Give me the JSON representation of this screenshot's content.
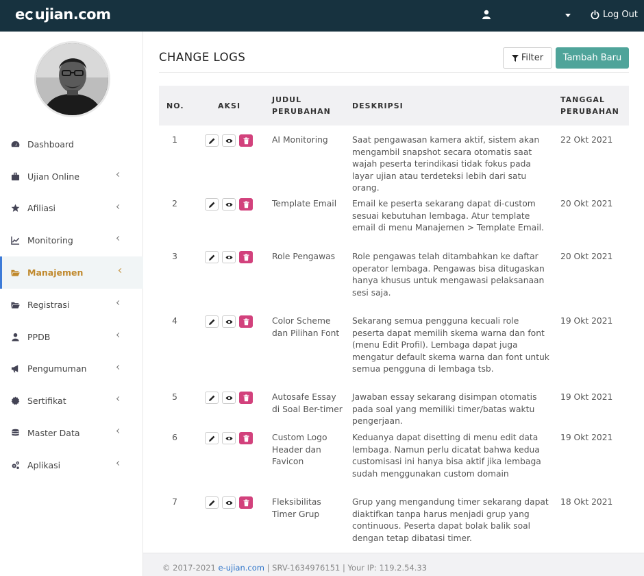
{
  "topbar": {
    "logo": "e-ujian.com",
    "logo_before": "e",
    "logo_after": "ujian.com",
    "logout_label": "Log Out"
  },
  "sidebar": {
    "items": [
      {
        "label": "Dashboard",
        "icon": "dashboard-icon",
        "has_chevron": false,
        "active": false
      },
      {
        "label": "Ujian Online",
        "icon": "briefcase-icon",
        "has_chevron": true,
        "active": false
      },
      {
        "label": "Afiliasi",
        "icon": "star-icon",
        "has_chevron": true,
        "active": false
      },
      {
        "label": "Monitoring",
        "icon": "line-chart-icon",
        "has_chevron": true,
        "active": false
      },
      {
        "label": "Manajemen",
        "icon": "folder-open-icon",
        "has_chevron": true,
        "active": true
      },
      {
        "label": "Registrasi",
        "icon": "folder-open-icon",
        "has_chevron": true,
        "active": false
      },
      {
        "label": "PPDB",
        "icon": "user-icon",
        "has_chevron": true,
        "active": false
      },
      {
        "label": "Pengumuman",
        "icon": "bullhorn-icon",
        "has_chevron": true,
        "active": false
      },
      {
        "label": "Sertifikat",
        "icon": "certificate-icon",
        "has_chevron": true,
        "active": false
      },
      {
        "label": "Master Data",
        "icon": "database-icon",
        "has_chevron": true,
        "active": false
      },
      {
        "label": "Aplikasi",
        "icon": "cogs-icon",
        "has_chevron": true,
        "active": false
      }
    ]
  },
  "page": {
    "title": "CHANGE LOGS",
    "filter_label": "Filter",
    "add_label": "Tambah Baru"
  },
  "table": {
    "headers": {
      "no": "NO.",
      "aksi": "AKSI",
      "judul": "JUDUL PERUBAHAN",
      "deskripsi": "DESKRIPSI",
      "tanggal": "TANGGAL PERUBAHAN"
    },
    "rows": [
      {
        "no": "1",
        "judul": "AI Monitoring",
        "deskripsi": "Saat pengawasan kamera aktif, sistem akan mengambil snapshot secara otomatis saat wajah peserta terindikasi tidak fokus pada layar ujian atau terdeteksi lebih dari satu orang.",
        "tanggal": "22 Okt 2021"
      },
      {
        "no": "2",
        "judul": "Template Email",
        "deskripsi": "Email ke peserta sekarang dapat di-custom sesuai kebutuhan lembaga. Atur template email di menu Manajemen > Template Email.",
        "tanggal": "20 Okt 2021"
      },
      {
        "no": "3",
        "judul": "Role Pengawas",
        "deskripsi": "Role pengawas telah ditambahkan ke daftar operator lembaga. Pengawas bisa ditugaskan hanya khusus untuk mengawasi pelaksanaan sesi saja.",
        "tanggal": "20 Okt 2021"
      },
      {
        "no": "4",
        "judul": "Color Scheme dan Pilihan Font",
        "deskripsi": "Sekarang semua pengguna kecuali role peserta dapat memilih skema warna dan font (menu Edit Profil). Lembaga dapat juga mengatur default skema warna dan font untuk semua pengguna di lembaga tsb.",
        "tanggal": "19 Okt 2021"
      },
      {
        "no": "5",
        "judul": "Autosafe Essay di Soal Ber-timer",
        "deskripsi": "Jawaban essay sekarang disimpan otomatis pada soal yang memiliki timer/batas waktu pengerjaan.",
        "tanggal": "19 Okt 2021"
      },
      {
        "no": "6",
        "judul": "Custom Logo Header dan Favicon",
        "deskripsi": "Keduanya dapat disetting di menu edit data lembaga. Namun perlu dicatat bahwa kedua customisasi ini hanya bisa aktif jika lembaga sudah menggunakan custom domain",
        "tanggal": "19 Okt 2021"
      },
      {
        "no": "7",
        "judul": "Fleksibilitas Timer Grup",
        "deskripsi": "Grup yang mengandung timer sekarang dapat diaktifkan tanpa harus menjadi grup yang continuous. Peserta dapat bolak balik soal dengan tetap dibatasi timer.",
        "tanggal": "18 Okt 2021"
      }
    ]
  },
  "footer": {
    "copyright": "© 2017-2021",
    "site_link": "e-ujian.com",
    "server": "| SRV-1634976151 | Your IP: 119.2.54.33"
  },
  "colors": {
    "topbar": "#17323f",
    "accent_green": "#4fa49a",
    "active_menu_text": "#c0892d",
    "delete_button": "#d2417c"
  }
}
